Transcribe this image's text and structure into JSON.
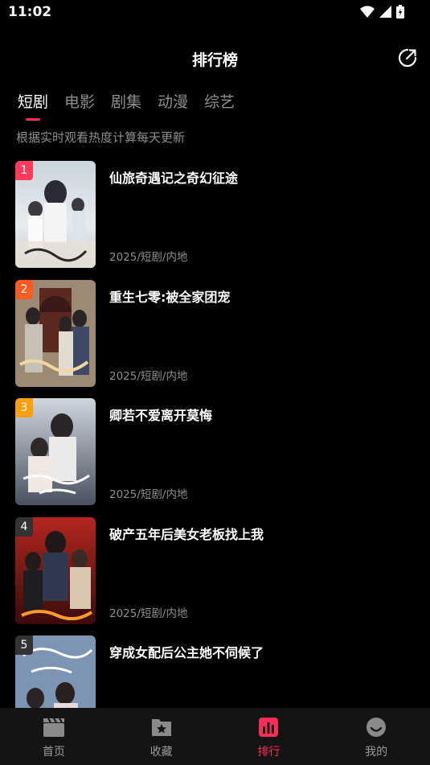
{
  "status": {
    "time": "11:02"
  },
  "header": {
    "title": "排行榜"
  },
  "tabs": [
    {
      "label": "短剧",
      "active": true
    },
    {
      "label": "电影",
      "active": false
    },
    {
      "label": "剧集",
      "active": false
    },
    {
      "label": "动漫",
      "active": false
    },
    {
      "label": "综艺",
      "active": false
    }
  ],
  "subtitle": "根据实时观看热度计算每天更新",
  "items": [
    {
      "rank": "1",
      "title": "仙旅奇遇记之奇幻征途",
      "meta": "2025/短剧/内地",
      "badge_color": "#ff3b5c"
    },
    {
      "rank": "2",
      "title": "重生七零:被全家团宠",
      "meta": "2025/短剧/内地",
      "badge_color": "#ff5a1f"
    },
    {
      "rank": "3",
      "title": "卿若不爱离开莫悔",
      "meta": "2025/短剧/内地",
      "badge_color": "#ff9f0a"
    },
    {
      "rank": "4",
      "title": "破产五年后美女老板找上我",
      "meta": "2025/短剧/内地",
      "badge_color": "#333333"
    },
    {
      "rank": "5",
      "title": "穿成女配后公主她不伺候了",
      "meta": "",
      "badge_color": "#333333"
    }
  ],
  "nav": [
    {
      "label": "首页",
      "icon": "clapperboard-icon",
      "active": false
    },
    {
      "label": "收藏",
      "icon": "folder-star-icon",
      "active": false
    },
    {
      "label": "排行",
      "icon": "chart-bars-icon",
      "active": true
    },
    {
      "label": "我的",
      "icon": "smile-face-icon",
      "active": false
    }
  ],
  "colors": {
    "accent": "#ff2d55",
    "background": "#000000",
    "muted": "#8e8e8e"
  }
}
